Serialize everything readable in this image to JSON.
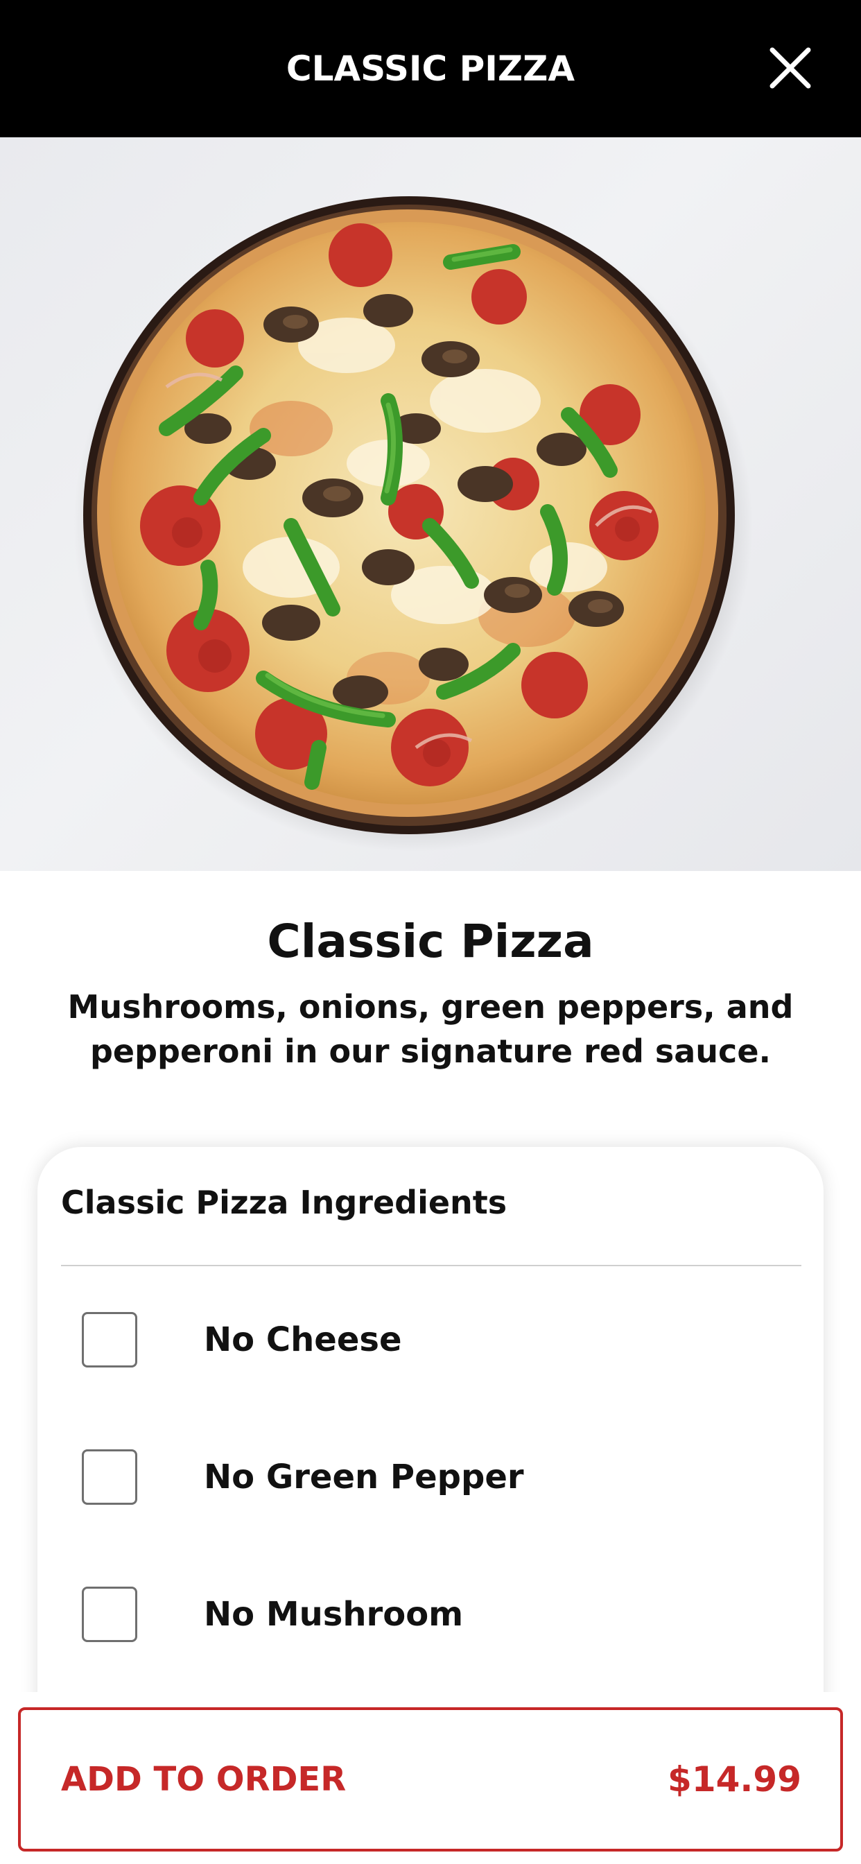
{
  "header": {
    "title": "CLASSIC PIZZA",
    "close_icon": "close-icon"
  },
  "product": {
    "name": "Classic Pizza",
    "description": "Mushrooms, onions, green peppers, and pepperoni in our signature red sauce."
  },
  "options": {
    "title": "Classic Pizza Ingredients",
    "items": [
      {
        "label": "No Cheese",
        "checked": false
      },
      {
        "label": "No Green Pepper",
        "checked": false
      },
      {
        "label": "No Mushroom",
        "checked": false
      }
    ]
  },
  "order": {
    "button_label": "ADD TO ORDER",
    "price": "$14.99"
  },
  "colors": {
    "header_bg": "#000000",
    "accent": "#c62828",
    "text": "#111111"
  }
}
